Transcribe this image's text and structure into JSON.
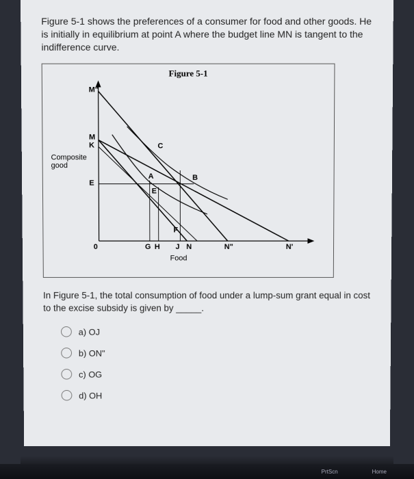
{
  "intro": "Figure 5-1 shows the preferences of a consumer for food and other goods. He is initially in equilibrium at point A where the budget line MN is tangent to the indifference curve.",
  "figure": {
    "title": "Figure 5-1",
    "y_axis_label": "Composite good",
    "x_axis_label": "Food",
    "point_labels": {
      "M_prime": "M\"",
      "M": "M",
      "K": "K",
      "C": "C",
      "E": "E",
      "A": "A",
      "E_sub": "E",
      "B": "B",
      "F": "F",
      "origin": "0",
      "G": "G",
      "H": "H",
      "J": "J",
      "N": "N",
      "N_prime": "N\"",
      "N_dprime": "N'"
    }
  },
  "question": "In Figure 5-1, the total consumption of food under a lump-sum grant equal in cost to the excise subsidy is given by _____.",
  "options": [
    {
      "id": "a",
      "label": "a) OJ"
    },
    {
      "id": "b",
      "label": "b) ON\""
    },
    {
      "id": "c",
      "label": "c) OG"
    },
    {
      "id": "d",
      "label": "d) OH"
    }
  ],
  "taskbar": {
    "prtscn": "PrtScn",
    "home": "Home"
  }
}
